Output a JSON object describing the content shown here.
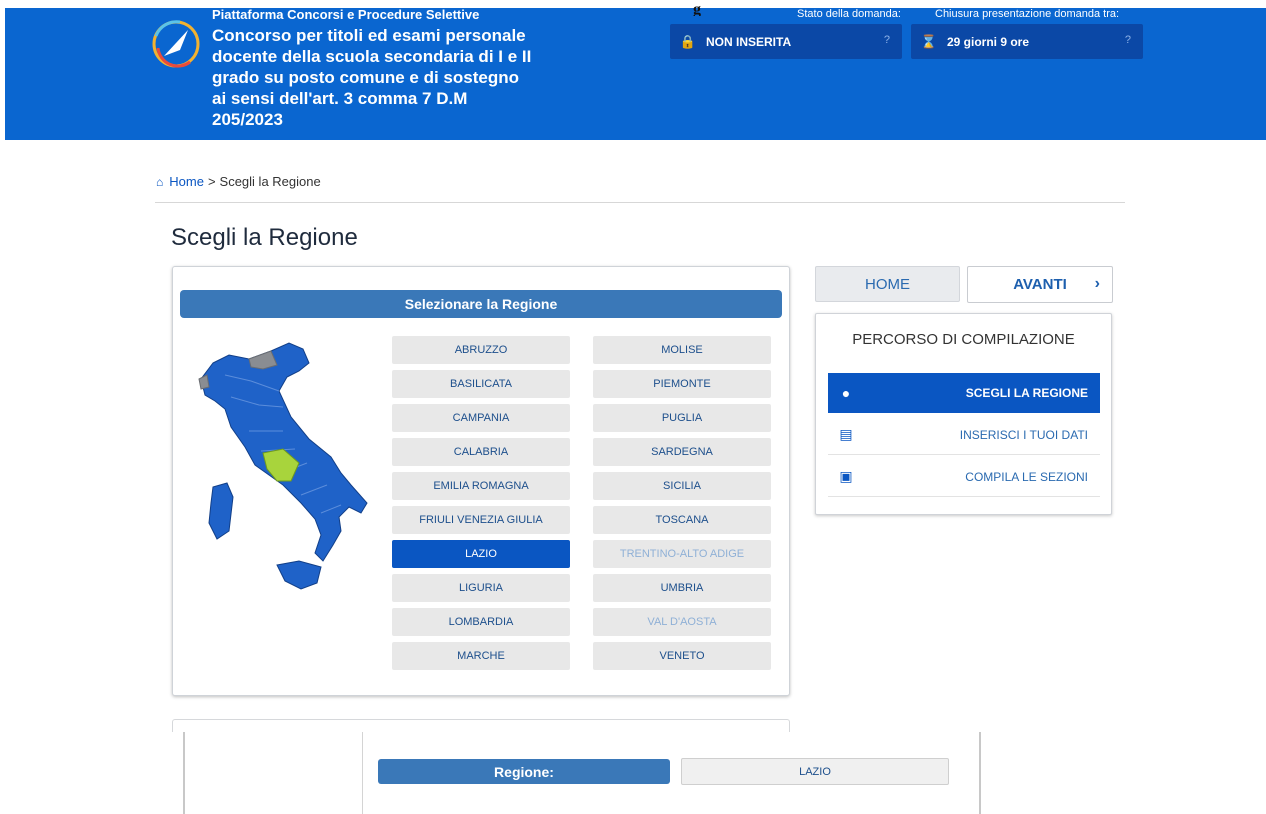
{
  "header": {
    "platform_name": "Piattaforma Concorsi e Procedure Selettive",
    "procedure_title": "Concorso per titoli ed esami personale docente della scuola secondaria di I e II grado su posto comune e di sostegno ai sensi dell'art. 3 comma 7 D.M 205/2023",
    "stray_glyph": "g",
    "status_label": "Stato della domanda:",
    "status_value": "NON INSERITA",
    "status_icon": "lock-icon",
    "deadline_label": "Chiusura presentazione domanda tra:",
    "deadline_value": "29 giorni 9 ore",
    "deadline_icon": "hourglass-icon",
    "help_symbol": "?",
    "accent_color": "#0a66d0"
  },
  "breadcrumb": {
    "home": "Home",
    "separator": ">",
    "current": "Scegli la Regione"
  },
  "page_title": "Scegli la Regione",
  "region_panel": {
    "header": "Selezionare la Regione",
    "highlighted_region": "LAZIO",
    "regions_col1": [
      {
        "label": "ABRUZZO",
        "state": "normal"
      },
      {
        "label": "BASILICATA",
        "state": "normal"
      },
      {
        "label": "CAMPANIA",
        "state": "normal"
      },
      {
        "label": "CALABRIA",
        "state": "normal"
      },
      {
        "label": "EMILIA ROMAGNA",
        "state": "normal"
      },
      {
        "label": "FRIULI VENEZIA GIULIA",
        "state": "normal"
      },
      {
        "label": "LAZIO",
        "state": "selected"
      },
      {
        "label": "LIGURIA",
        "state": "normal"
      },
      {
        "label": "LOMBARDIA",
        "state": "normal"
      },
      {
        "label": "MARCHE",
        "state": "normal"
      }
    ],
    "regions_col2": [
      {
        "label": "MOLISE",
        "state": "normal"
      },
      {
        "label": "PIEMONTE",
        "state": "normal"
      },
      {
        "label": "PUGLIA",
        "state": "normal"
      },
      {
        "label": "SARDEGNA",
        "state": "normal"
      },
      {
        "label": "SICILIA",
        "state": "normal"
      },
      {
        "label": "TOSCANA",
        "state": "normal"
      },
      {
        "label": "TRENTINO-ALTO ADIGE",
        "state": "disabled"
      },
      {
        "label": "UMBRIA",
        "state": "normal"
      },
      {
        "label": "VAL D'AOSTA",
        "state": "disabled"
      },
      {
        "label": "VENETO",
        "state": "normal"
      }
    ]
  },
  "nav": {
    "home_label": "HOME",
    "next_label": "AVANTI",
    "next_icon": "chevron-right-icon"
  },
  "steps": {
    "title": "PERCORSO DI COMPILAZIONE",
    "items": [
      {
        "label": "SCEGLI LA REGIONE",
        "icon": "map-marker-icon",
        "active": true
      },
      {
        "label": "INSERISCI I TUOI DATI",
        "icon": "id-card-icon",
        "active": false
      },
      {
        "label": "COMPILA LE SEZIONI",
        "icon": "briefcase-icon",
        "active": false
      }
    ]
  },
  "summary": {
    "label": "Regione:",
    "value": "LAZIO"
  },
  "colors": {
    "primary": "#0a56c2",
    "panel_header": "#3a78b8",
    "map_region": "#1f62c8",
    "map_selected": "#a8d43c",
    "map_disabled": "#8a8d92"
  }
}
